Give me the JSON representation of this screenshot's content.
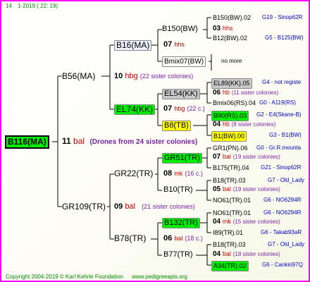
{
  "header": {
    "n": "14",
    "date": "1-2019",
    "time": "( 22: 19)"
  },
  "root": {
    "name": "B116(MA)"
  },
  "root_info": {
    "num": "11",
    "unit": "bal",
    "note": "(Drones from 24 sister colonies)"
  },
  "gen1": {
    "upper": {
      "name": "B56(MA)",
      "num": "10",
      "unit": "hbg",
      "note": "(22 sister colonies)"
    },
    "lower": {
      "name": "GR109(TR)",
      "num": "09",
      "unit": "bal",
      "note": "(21 sister colonies)"
    }
  },
  "gen2": {
    "b16": {
      "name": "B16(MA)",
      "num": "07",
      "unit": "hhs"
    },
    "el74": {
      "name": "EL74(KK)",
      "num": "07",
      "unit": "hbg",
      "note": "(22 c.)"
    },
    "gr22": {
      "name": "GR22(TR)",
      "num": "08",
      "unit": "mk",
      "note": "(16 c.)"
    },
    "b78": {
      "name": "B78(TR)",
      "num": "06",
      "unit": "bal",
      "note": "(18 c.)"
    }
  },
  "gen3": {
    "b150": {
      "name": "B150(BW)",
      "num": "03",
      "unit": "hhs"
    },
    "bmix07": {
      "name": "Bmix07(BW)",
      "note": "no more"
    },
    "el54": {
      "name": "EL54(KK)",
      "num": "06",
      "unit": "hb",
      "note": "(11 sister colonies)"
    },
    "b8": {
      "name": "B8(TB)",
      "num": "04",
      "unit": "hb",
      "note": "(8 sister colonies)"
    },
    "gr51": {
      "name": "GR51(TR)",
      "num": "07",
      "unit": "bal",
      "note": "(19 sister colonies)"
    },
    "b10": {
      "name": "B10(TR)",
      "num": "05",
      "unit": "bal",
      "note": "(19 sister colonies)"
    },
    "b132": {
      "name": "B132(TR)",
      "num": "04",
      "unit": "mk",
      "note": "(15 sister colonies)"
    },
    "b77": {
      "name": "B77(TR)",
      "num": "04",
      "unit": "bal",
      "note": "(18 sister colonies)"
    }
  },
  "gen4": [
    {
      "name": "B150(BW).02",
      "info": "G19 - Sinop62R"
    },
    {
      "name": "B12(BW).02",
      "info": "G5 - B125(BW)"
    },
    {
      "name": "EL89(KK).05",
      "info": "G4 - not registe"
    },
    {
      "name": "Bmix06(RS).04",
      "info": "G0 - A119(RS)"
    },
    {
      "name": "B90(RS).03",
      "info": "G2 - E4(Skane-B)"
    },
    {
      "name": "B1(BW).00",
      "info": "G3 - B1(BW)"
    },
    {
      "name": "GR1(PN).06",
      "info": "G0 - Gr.R.mounta"
    },
    {
      "name": "B175(TR).04",
      "info": "G21 - Sinop62R"
    },
    {
      "name": "B18(TR).03",
      "info": "G7 - Old_Lady"
    },
    {
      "name": "NO61(TR).01",
      "info": "G6 - NO6294R"
    },
    {
      "name": "NO61(TR).01",
      "info": "G6 - NO6294R"
    },
    {
      "name": "I89(TR).01",
      "info": "G6 - Takab93aR"
    },
    {
      "name": "B18(TR).03",
      "info": "G7 - Old_Lady"
    },
    {
      "name": "A34(TR).02",
      "info": "G6 - Cankiri97Q"
    }
  ],
  "footer": {
    "copyright": "Copyright 2004-2019 © Karl Kehrle Foundation",
    "url": "www.pedigreeapis.org"
  },
  "colors": {
    "border": "#ff00ff",
    "highlight_green": "#00ee00",
    "highlight_yellow": "#ffff00",
    "highlight_grey": "#c8c8c8",
    "info_blue": "#0000cc",
    "footer_green": "#008800"
  }
}
